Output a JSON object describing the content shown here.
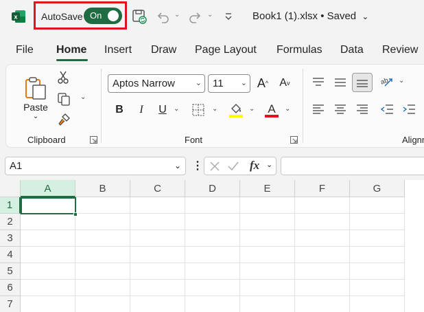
{
  "titlebar": {
    "autosave_label": "AutoSave",
    "autosave_state": "On",
    "document_title": "Book1 (1).xlsx • Saved",
    "icons": [
      "excel-logo-icon",
      "save-icon",
      "undo-icon",
      "redo-icon",
      "customize-toolbar-icon"
    ]
  },
  "tabs": [
    {
      "label": "File",
      "active": false
    },
    {
      "label": "Home",
      "active": true
    },
    {
      "label": "Insert",
      "active": false
    },
    {
      "label": "Draw",
      "active": false
    },
    {
      "label": "Page Layout",
      "active": false
    },
    {
      "label": "Formulas",
      "active": false
    },
    {
      "label": "Data",
      "active": false
    },
    {
      "label": "Review",
      "active": false
    }
  ],
  "ribbon": {
    "clipboard": {
      "label": "Clipboard",
      "paste_label": "Paste"
    },
    "font": {
      "label": "Font",
      "font_name": "Aptos Narrow",
      "font_size": "11",
      "bold": "B",
      "italic": "I",
      "underline": "U",
      "fill_color": "#ffff00",
      "font_color": "#e0131e"
    },
    "alignment": {
      "label": "Alignm"
    }
  },
  "formula_bar": {
    "name_box": "A1",
    "fx_label": "fx",
    "formula": ""
  },
  "grid": {
    "columns": [
      "A",
      "B",
      "C",
      "D",
      "E",
      "F",
      "G"
    ],
    "rows": [
      "1",
      "2",
      "3",
      "4",
      "5",
      "6",
      "7"
    ],
    "selected_cell": "A1"
  },
  "colors": {
    "accent": "#1e6c41",
    "highlight_box": "#e0131e"
  }
}
